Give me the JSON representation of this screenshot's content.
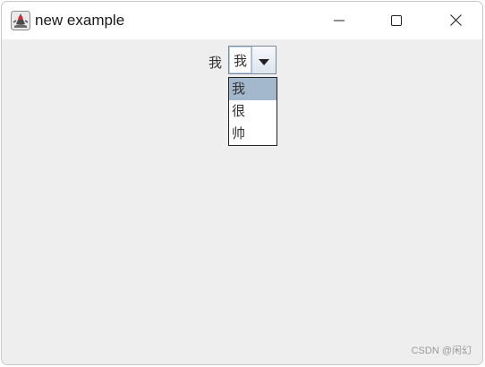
{
  "window": {
    "title": "new example",
    "app_icon": "java-duke-icon",
    "controls": {
      "minimize_icon": "minimize-icon",
      "maximize_icon": "maximize-icon",
      "close_icon": "close-icon"
    }
  },
  "form": {
    "label": "我",
    "combo": {
      "selected_value": "我",
      "arrow_icon": "chevron-down-icon",
      "options": [
        "我",
        "很",
        "帅"
      ],
      "highlighted_index": 0
    }
  },
  "watermark": "CSDN @闲幻",
  "colors": {
    "background": "#eeeeee",
    "selection": "#a3b8cc"
  }
}
